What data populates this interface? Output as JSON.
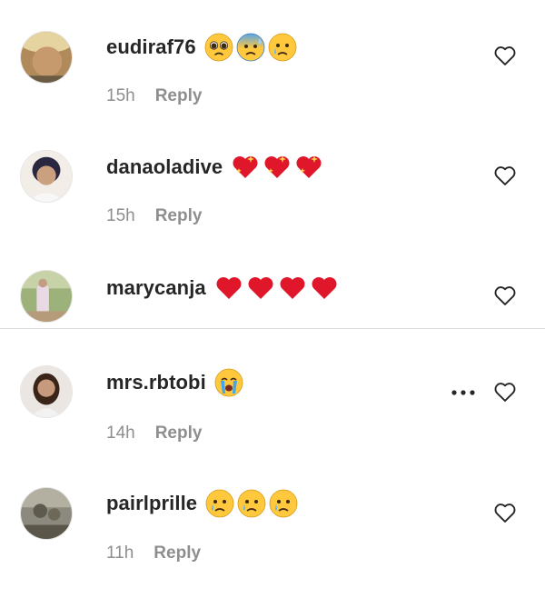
{
  "comments": [
    {
      "username": "eudiraf76",
      "time": "15h",
      "reply_label": "Reply",
      "emojis": [
        "pleading-face",
        "anxious-face-with-sweat",
        "sad-but-relieved-face"
      ],
      "liked": false
    },
    {
      "username": "danaoladive",
      "time": "15h",
      "reply_label": "Reply",
      "emojis": [
        "sparkling-heart",
        "sparkling-heart",
        "sparkling-heart"
      ],
      "liked": false
    },
    {
      "username": "marycanja",
      "emojis": [
        "red-heart",
        "red-heart",
        "red-heart",
        "red-heart"
      ],
      "liked": false
    },
    {
      "username": "mrs.rbtobi",
      "time": "14h",
      "reply_label": "Reply",
      "emojis": [
        "loudly-crying-face"
      ],
      "liked": false,
      "has_more_menu": true
    },
    {
      "username": "pairlprille",
      "time": "11h",
      "reply_label": "Reply",
      "emojis": [
        "sad-but-relieved-face",
        "sad-but-relieved-face",
        "sad-but-relieved-face"
      ],
      "liked": false
    }
  ],
  "icons": {
    "like": "heart-outline-icon",
    "more": "more-options-icon"
  },
  "colors": {
    "text": "#262626",
    "secondary": "#8e8e8e",
    "divider": "#dbdbdb",
    "heart_red": "#e0162b",
    "emoji_yellow": "#ffc83d"
  }
}
